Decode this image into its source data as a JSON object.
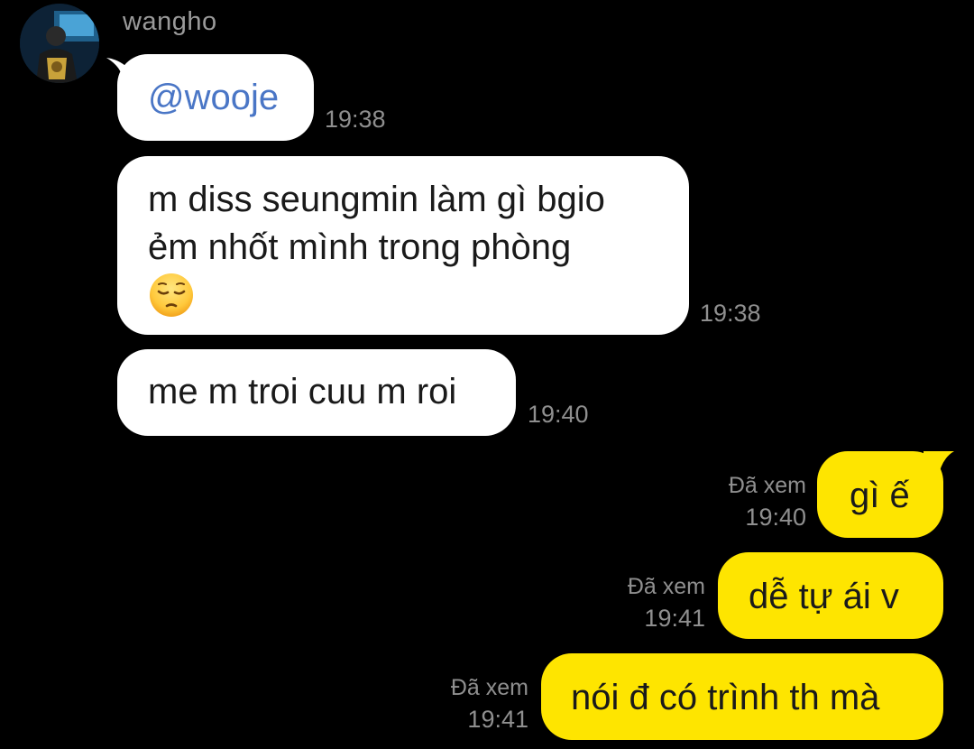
{
  "chat": {
    "sender": {
      "name": "wangho",
      "avatar_icon": "user-avatar-photo"
    },
    "incoming": [
      {
        "text": "@wooje",
        "time": "19:38",
        "is_mention": true
      },
      {
        "lines": [
          "m diss seungmin làm gì bgio",
          "ẻm nhốt mình trong phòng"
        ],
        "emoji": "pensive-face-emoji",
        "time": "19:38"
      },
      {
        "text": "me m troi cuu m roi",
        "time": "19:40"
      }
    ],
    "outgoing": [
      {
        "text": "gì ế",
        "status": "Đã xem",
        "time": "19:40"
      },
      {
        "text": "dễ tự ái v",
        "status": "Đã xem",
        "time": "19:41"
      },
      {
        "text": "nói đ có trình th mà",
        "status": "Đã xem",
        "time": "19:41"
      }
    ]
  },
  "colors": {
    "background": "#000000",
    "incoming_bubble": "#ffffff",
    "outgoing_bubble": "#fee500",
    "mention": "#4a76c6",
    "meta_text": "#8f8f8f"
  }
}
